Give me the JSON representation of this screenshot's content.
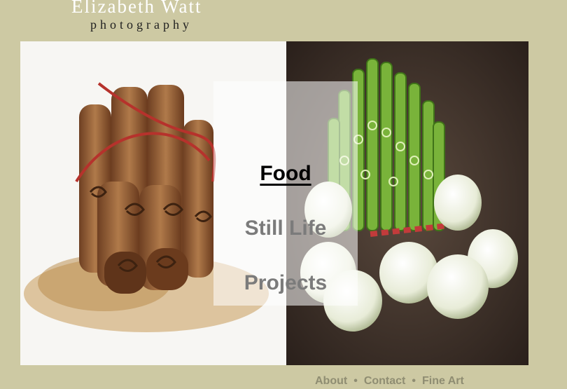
{
  "brand": {
    "name": "Elizabeth Watt",
    "tagline": "photography"
  },
  "menu": {
    "items": [
      {
        "label": "Food",
        "active": true
      },
      {
        "label": "Still Life",
        "active": false
      },
      {
        "label": "Projects",
        "active": false
      }
    ]
  },
  "footer": {
    "links": [
      "About",
      "Contact",
      "Fine Art"
    ],
    "separator": "•"
  },
  "colors": {
    "background": "#cdc9a3",
    "active_menu": "#000000",
    "inactive_menu": "#7b7b7b",
    "footer_link": "#8f8d72"
  }
}
